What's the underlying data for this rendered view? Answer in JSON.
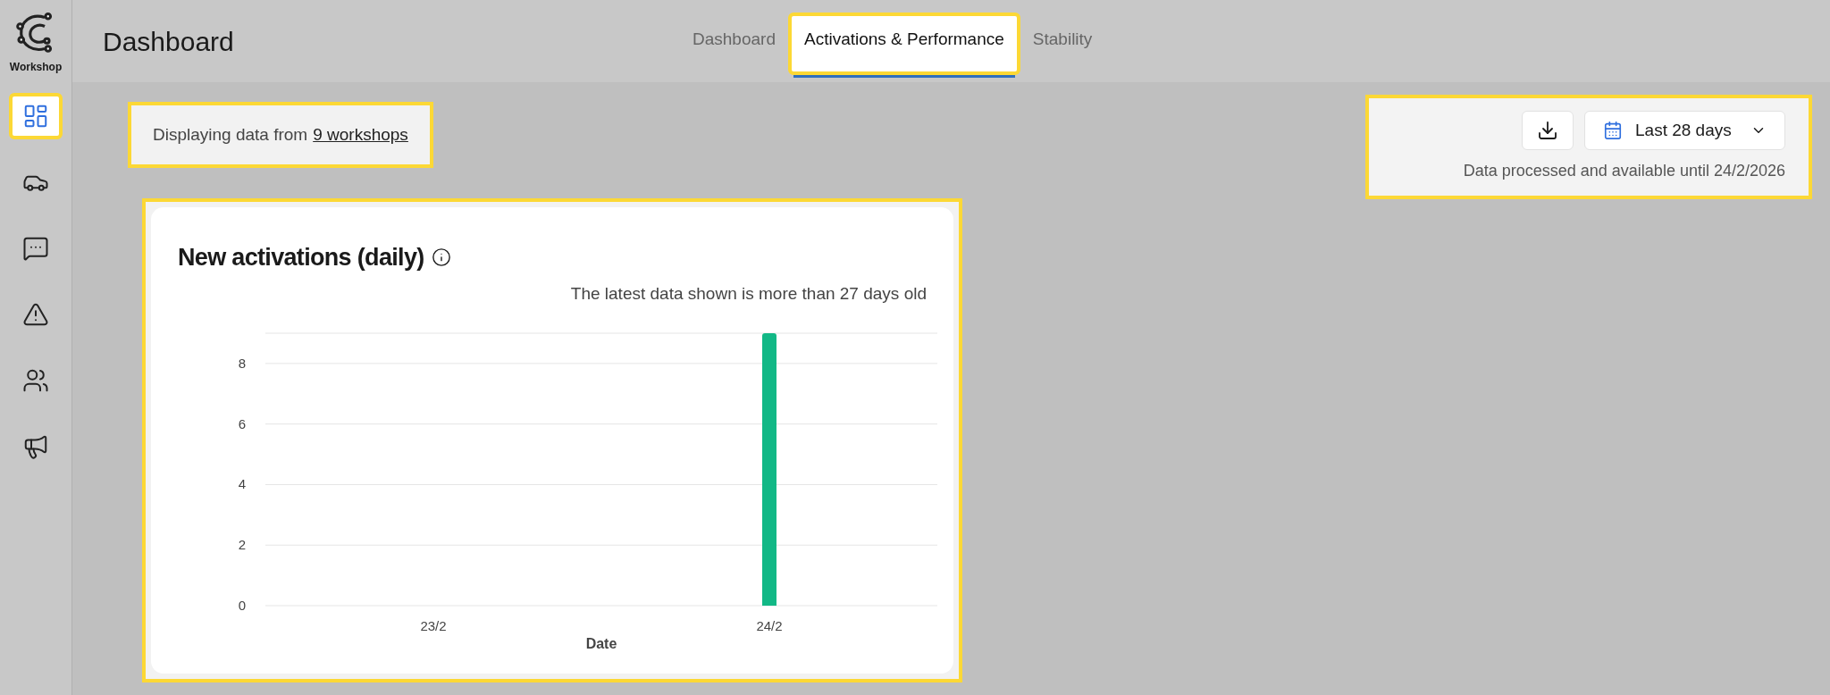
{
  "logo": {
    "label": "Workshop"
  },
  "sidebar": {
    "items": [
      {
        "kind": "dashboard",
        "selected": true,
        "highlighted": true
      },
      {
        "kind": "vehicles",
        "selected": false,
        "highlighted": false
      },
      {
        "kind": "messages",
        "selected": false,
        "highlighted": false
      },
      {
        "kind": "alerts",
        "selected": false,
        "highlighted": false
      },
      {
        "kind": "users",
        "selected": false,
        "highlighted": false
      },
      {
        "kind": "campaigns",
        "selected": false,
        "highlighted": false
      }
    ]
  },
  "header": {
    "title": "Dashboard"
  },
  "tabs": [
    {
      "label": "Dashboard",
      "selected": false,
      "highlighted": false
    },
    {
      "label": "Activations & Performance",
      "selected": true,
      "highlighted": true
    },
    {
      "label": "Stability",
      "selected": false,
      "highlighted": false
    }
  ],
  "source_notice": {
    "text": "Displaying data from",
    "link": "9 workshops",
    "highlighted": true
  },
  "controls": {
    "highlighted": true,
    "date_range": "Last 28 days",
    "footnote": "Data processed and available until 24/2/2026"
  },
  "card": {
    "title": "New activations (daily)",
    "highlighted": true,
    "notice": "The latest data shown is more than 27 days old",
    "chart_data": {
      "type": "bar",
      "xlabel": "Date",
      "categories": [
        "23/2",
        "24/2"
      ],
      "series": [
        {
          "color": "#12b886",
          "values": [
            0,
            9
          ]
        }
      ],
      "grid": true,
      "ylim": [
        0,
        9
      ],
      "yticks": [
        0,
        2,
        4,
        6,
        8
      ]
    }
  }
}
